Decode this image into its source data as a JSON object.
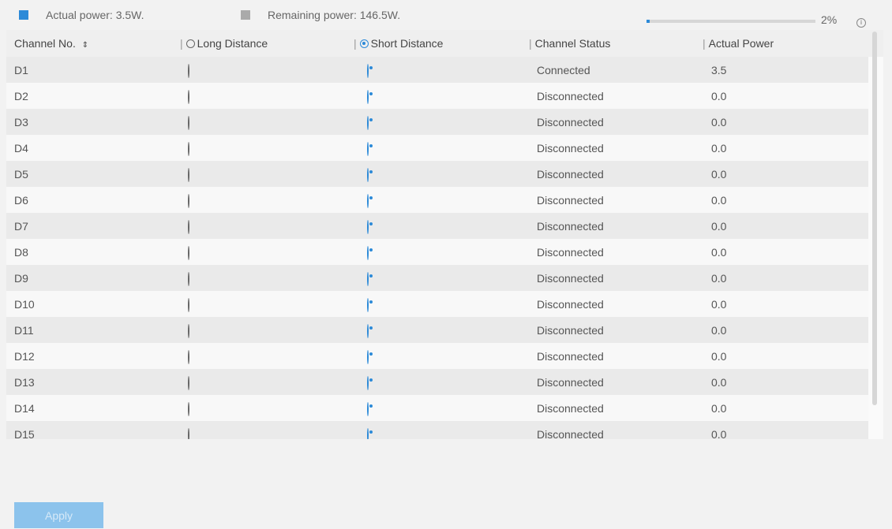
{
  "header": {
    "actual_power": "Actual power: 3.5W.",
    "remaining_power": "Remaining power: 146.5W.",
    "usage_percent": "2%",
    "usage_fraction": 0.02,
    "actual_color": "#2c8ad8",
    "remaining_color": "#aaaaaa",
    "info_icon": "info-icon"
  },
  "table": {
    "columns": {
      "channel": "Channel No.",
      "long_distance": "Long Distance",
      "short_distance": "Short Distance",
      "status": "Channel Status",
      "power": "Actual Power"
    },
    "rows": [
      {
        "channel": "D1",
        "long": false,
        "short": true,
        "status": "Connected",
        "power": "3.5"
      },
      {
        "channel": "D2",
        "long": false,
        "short": true,
        "status": "Disconnected",
        "power": "0.0"
      },
      {
        "channel": "D3",
        "long": false,
        "short": true,
        "status": "Disconnected",
        "power": "0.0"
      },
      {
        "channel": "D4",
        "long": false,
        "short": true,
        "status": "Disconnected",
        "power": "0.0"
      },
      {
        "channel": "D5",
        "long": false,
        "short": true,
        "status": "Disconnected",
        "power": "0.0"
      },
      {
        "channel": "D6",
        "long": false,
        "short": true,
        "status": "Disconnected",
        "power": "0.0"
      },
      {
        "channel": "D7",
        "long": false,
        "short": true,
        "status": "Disconnected",
        "power": "0.0"
      },
      {
        "channel": "D8",
        "long": false,
        "short": true,
        "status": "Disconnected",
        "power": "0.0"
      },
      {
        "channel": "D9",
        "long": false,
        "short": true,
        "status": "Disconnected",
        "power": "0.0"
      },
      {
        "channel": "D10",
        "long": false,
        "short": true,
        "status": "Disconnected",
        "power": "0.0"
      },
      {
        "channel": "D11",
        "long": false,
        "short": true,
        "status": "Disconnected",
        "power": "0.0"
      },
      {
        "channel": "D12",
        "long": false,
        "short": true,
        "status": "Disconnected",
        "power": "0.0"
      },
      {
        "channel": "D13",
        "long": false,
        "short": true,
        "status": "Disconnected",
        "power": "0.0"
      },
      {
        "channel": "D14",
        "long": false,
        "short": true,
        "status": "Disconnected",
        "power": "0.0"
      },
      {
        "channel": "D15",
        "long": false,
        "short": true,
        "status": "Disconnected",
        "power": "0.0"
      }
    ]
  },
  "footer": {
    "apply_label": "Apply"
  }
}
